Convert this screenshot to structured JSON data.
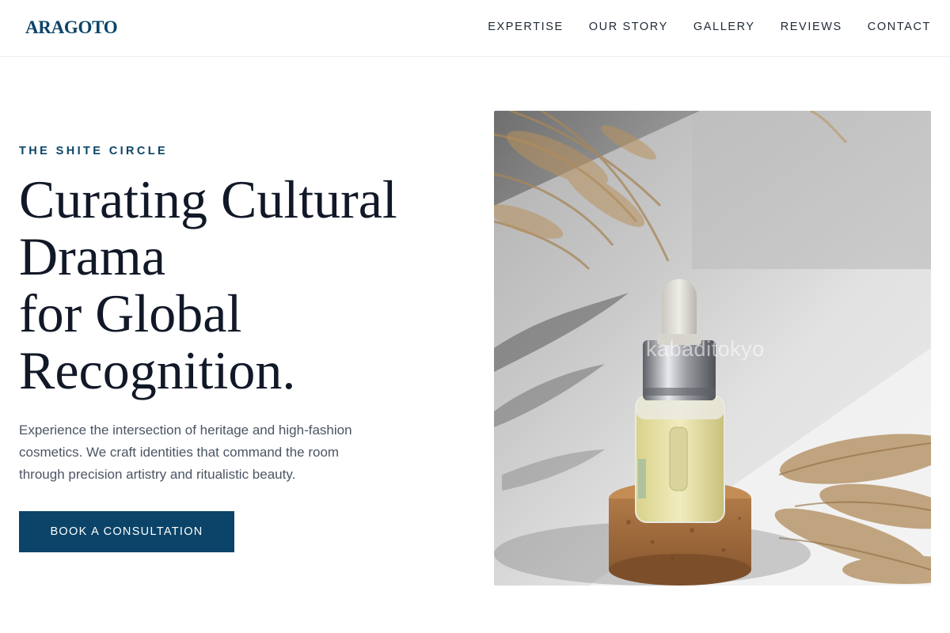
{
  "header": {
    "logo": "ARAGOTO",
    "nav": [
      "EXPERTISE",
      "OUR STORY",
      "GALLERY",
      "REVIEWS",
      "CONTACT"
    ]
  },
  "hero": {
    "eyebrow": "THE SHITE CIRCLE",
    "headline_lines": [
      "Curating Cultural",
      "Drama",
      "for Global",
      "Recognition."
    ],
    "lead_lines": [
      "Experience the intersection of heritage and high-fashion",
      "cosmetics. We craft identities that command the room",
      "through precision artistry and ritualistic beauty."
    ],
    "cta": "BOOK A CONSULTATION",
    "image": {
      "subject": "serum dropper bottle on cork stand with dried pampas grass",
      "watermark": "kabaditokyo"
    }
  },
  "colors": {
    "brand": "#0b4468",
    "text": "#111827",
    "muted": "#4b5563"
  }
}
